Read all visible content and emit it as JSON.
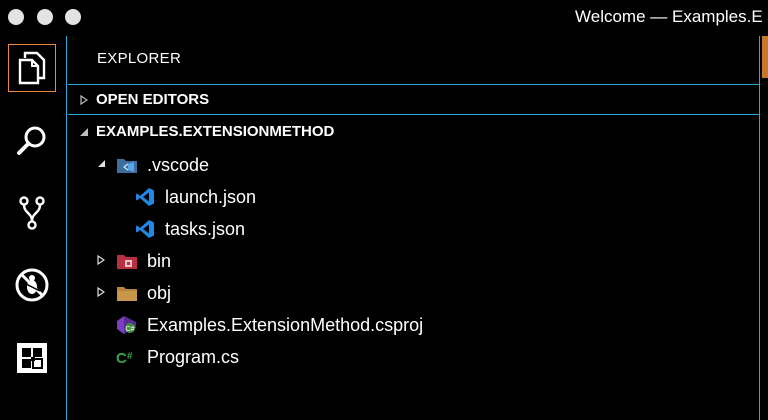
{
  "window": {
    "title": "Welcome — Examples.E"
  },
  "activity_bar": {
    "items": [
      {
        "name": "explorer",
        "icon": "files-icon",
        "active": true
      },
      {
        "name": "search",
        "icon": "search-icon",
        "active": false
      },
      {
        "name": "source-control",
        "icon": "source-control-icon",
        "active": false
      },
      {
        "name": "debug",
        "icon": "debug-icon",
        "active": false
      },
      {
        "name": "extensions",
        "icon": "extensions-icon",
        "active": false
      }
    ]
  },
  "sidebar": {
    "title": "EXPLORER",
    "sections": {
      "open_editors": {
        "label": "OPEN EDITORS",
        "expanded": false
      },
      "project": {
        "label": "EXAMPLES.EXTENSIONMETHOD",
        "expanded": true
      }
    },
    "tree": [
      {
        "label": ".vscode",
        "icon": "vscode-folder-icon",
        "expanded": true,
        "depth": 1
      },
      {
        "label": "launch.json",
        "icon": "vscode-file-icon",
        "depth": 2
      },
      {
        "label": "tasks.json",
        "icon": "vscode-file-icon",
        "depth": 2
      },
      {
        "label": "bin",
        "icon": "bin-folder-icon",
        "expanded": false,
        "depth": 1
      },
      {
        "label": "obj",
        "icon": "folder-icon",
        "expanded": false,
        "depth": 1
      },
      {
        "label": "Examples.ExtensionMethod.csproj",
        "icon": "csproj-icon",
        "depth": 1
      },
      {
        "label": "Program.cs",
        "icon": "csharp-icon",
        "depth": 1
      }
    ]
  },
  "colors": {
    "accent_border": "#2aa7d6",
    "active_indicator": "#f0883a",
    "background": "#000000"
  }
}
